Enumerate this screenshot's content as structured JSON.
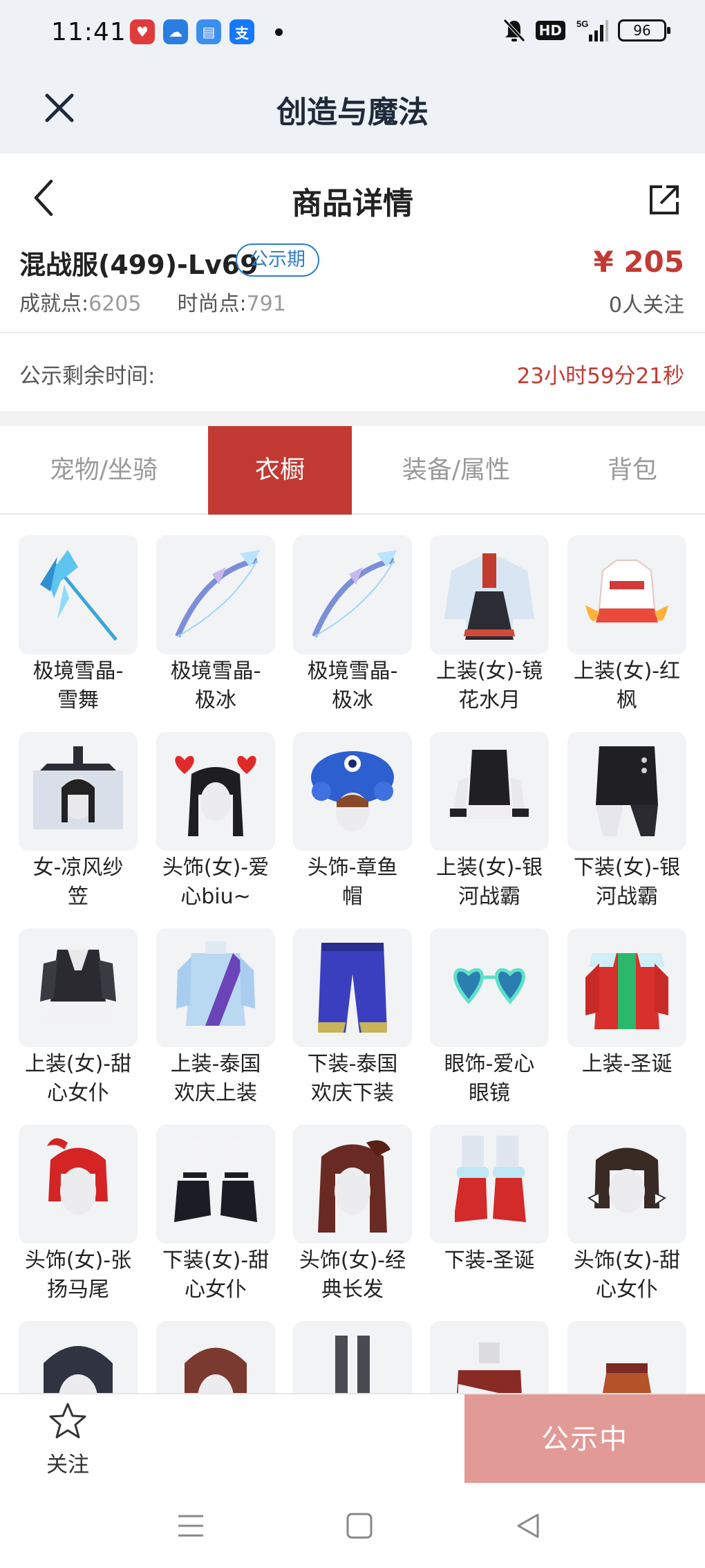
{
  "status_bar": {
    "time": "11:41",
    "battery": "96",
    "hd": "HD",
    "network": "5G"
  },
  "app": {
    "title": "创造与魔法"
  },
  "page": {
    "title": "商品详情"
  },
  "item": {
    "name": "混战服(499)-Lv69",
    "badge": "公示期",
    "price": "¥ 205",
    "achievement_label": "成就点:",
    "achievement_value": "6205",
    "fashion_label": "时尚点:",
    "fashion_value": "791",
    "followers": "0人关注"
  },
  "countdown": {
    "label": "公示剩余时间:",
    "value": "23小时59分21秒"
  },
  "tabs": [
    {
      "label": "宠物/坐骑",
      "active": false
    },
    {
      "label": "衣橱",
      "active": true
    },
    {
      "label": "装备/属性",
      "active": false
    },
    {
      "label": "背包",
      "active": false
    }
  ],
  "items": [
    {
      "label": "极境雪晶-雪舞",
      "line1": "极境雪晶-",
      "line2": "雪舞"
    },
    {
      "label": "极境雪晶-极冰",
      "line1": "极境雪晶-",
      "line2": "极冰"
    },
    {
      "label": "极境雪晶-极冰",
      "line1": "极境雪晶-",
      "line2": "极冰"
    },
    {
      "label": "上装(女)-镜花水月",
      "line1": "上装(女)-镜",
      "line2": "花水月"
    },
    {
      "label": "上装(女)-红枫",
      "line1": "上装(女)-红",
      "line2": "枫"
    },
    {
      "label": "女-凉风纱笠",
      "line1": "女-凉风纱",
      "line2": "笠"
    },
    {
      "label": "头饰(女)-爱心biu~",
      "line1": "头饰(女)-爱",
      "line2": "心biu~"
    },
    {
      "label": "头饰-章鱼帽",
      "line1": "头饰-章鱼",
      "line2": "帽"
    },
    {
      "label": "上装(女)-银河战霸",
      "line1": "上装(女)-银",
      "line2": "河战霸"
    },
    {
      "label": "下装(女)-银河战霸",
      "line1": "下装(女)-银",
      "line2": "河战霸"
    },
    {
      "label": "上装(女)-甜心女仆",
      "line1": "上装(女)-甜",
      "line2": "心女仆"
    },
    {
      "label": "上装-泰国欢庆上装",
      "line1": "上装-泰国",
      "line2": "欢庆上装"
    },
    {
      "label": "下装-泰国欢庆下装",
      "line1": "下装-泰国",
      "line2": "欢庆下装"
    },
    {
      "label": "眼饰-爱心眼镜",
      "line1": "眼饰-爱心",
      "line2": "眼镜"
    },
    {
      "label": "上装-圣诞",
      "line1": "上装-圣诞",
      "line2": ""
    },
    {
      "label": "头饰(女)-张扬马尾",
      "line1": "头饰(女)-张",
      "line2": "扬马尾"
    },
    {
      "label": "下装(女)-甜心女仆",
      "line1": "下装(女)-甜",
      "line2": "心女仆"
    },
    {
      "label": "头饰(女)-经典长发",
      "line1": "头饰(女)-经",
      "line2": "典长发"
    },
    {
      "label": "下装-圣诞",
      "line1": "下装-圣诞",
      "line2": ""
    },
    {
      "label": "头饰(女)-甜心女仆",
      "line1": "头饰(女)-甜",
      "line2": "心女仆"
    }
  ],
  "bottom": {
    "follow_label": "关注",
    "action_label": "公示中"
  },
  "colors": {
    "accent": "#c23a33",
    "badge": "#2f7dc9",
    "action_disabled": "#e29a97",
    "header_bg": "#eef1f6"
  }
}
